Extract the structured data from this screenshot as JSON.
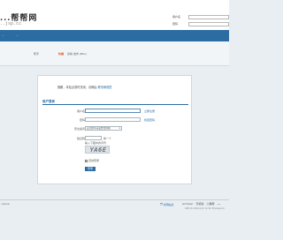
{
  "header": {
    "logo_main": "...帮帮网",
    "logo_sub": "..jsp.cc",
    "login": {
      "username_label": "用户名",
      "password_label": "密码"
    }
  },
  "nav": {
    "items": [
      "...",
      "..."
    ]
  },
  "subnav": {
    "left_label": "帮手",
    "active_label": "快捷",
    "rest_label": "投稿 发布 (Bbs)"
  },
  "panel": {
    "notice_prefix": "抱歉，本站点暂时关闭，请稍后 ",
    "notice_link": "联系管理员",
    "section_title": "用户登录",
    "fields": {
      "username_label": "用户名",
      "username_tip": "立即注册",
      "password_label": "密码",
      "password_tip": "找回密码",
      "question_label": "安全提问",
      "question_value": "安全提问(未设置请忽略)",
      "captcha_label": "验证码",
      "captcha_refresh": "换一个"
    },
    "captcha_hint": "输入下图中的字符",
    "captcha_code": "YA6E",
    "remember_label": "自动登录",
    "submit_label": "登录"
  },
  "footer": {
    "left_text": "..cense",
    "badge_text": "文明站点",
    "links": [
      "Archiver",
      "手机版",
      "小黑屋"
    ],
    "links_strong": "...",
    "meta_text": "GMT+8, 2024-4-15 11:30, Processed in"
  },
  "colors": {
    "accent": "#2b6ca3",
    "active": "#e05a1a",
    "background": "#e9eef2"
  }
}
